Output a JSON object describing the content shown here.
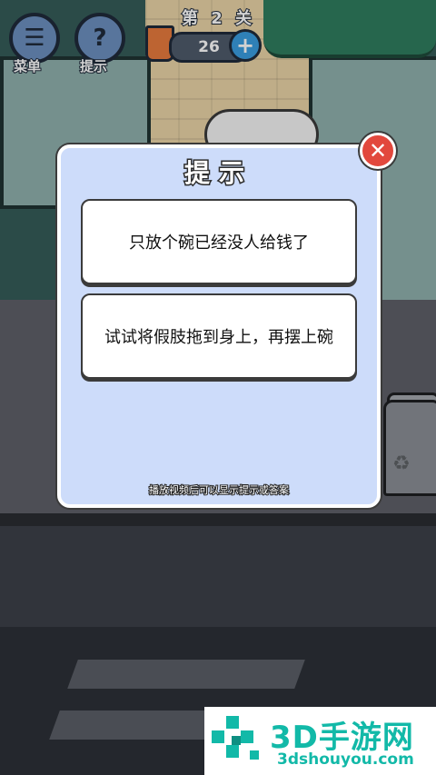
{
  "hud": {
    "menu_label": "菜单",
    "hint_label": "提示",
    "level_text": "第 2 关",
    "coin_count": "26"
  },
  "dialog": {
    "title": "提示",
    "hints": [
      "只放个碗已经没人给钱了",
      "试试将假肢拖到身上，再摆上碗"
    ],
    "footer": "播放视频后可以显示提示或答案"
  },
  "watermark": {
    "brand": "3D手游网",
    "url": "3dshouyou.com"
  },
  "colors": {
    "dialog_bg": "#cddcfa",
    "close_red": "#e2483d",
    "brand_teal": "#12b9a8"
  }
}
